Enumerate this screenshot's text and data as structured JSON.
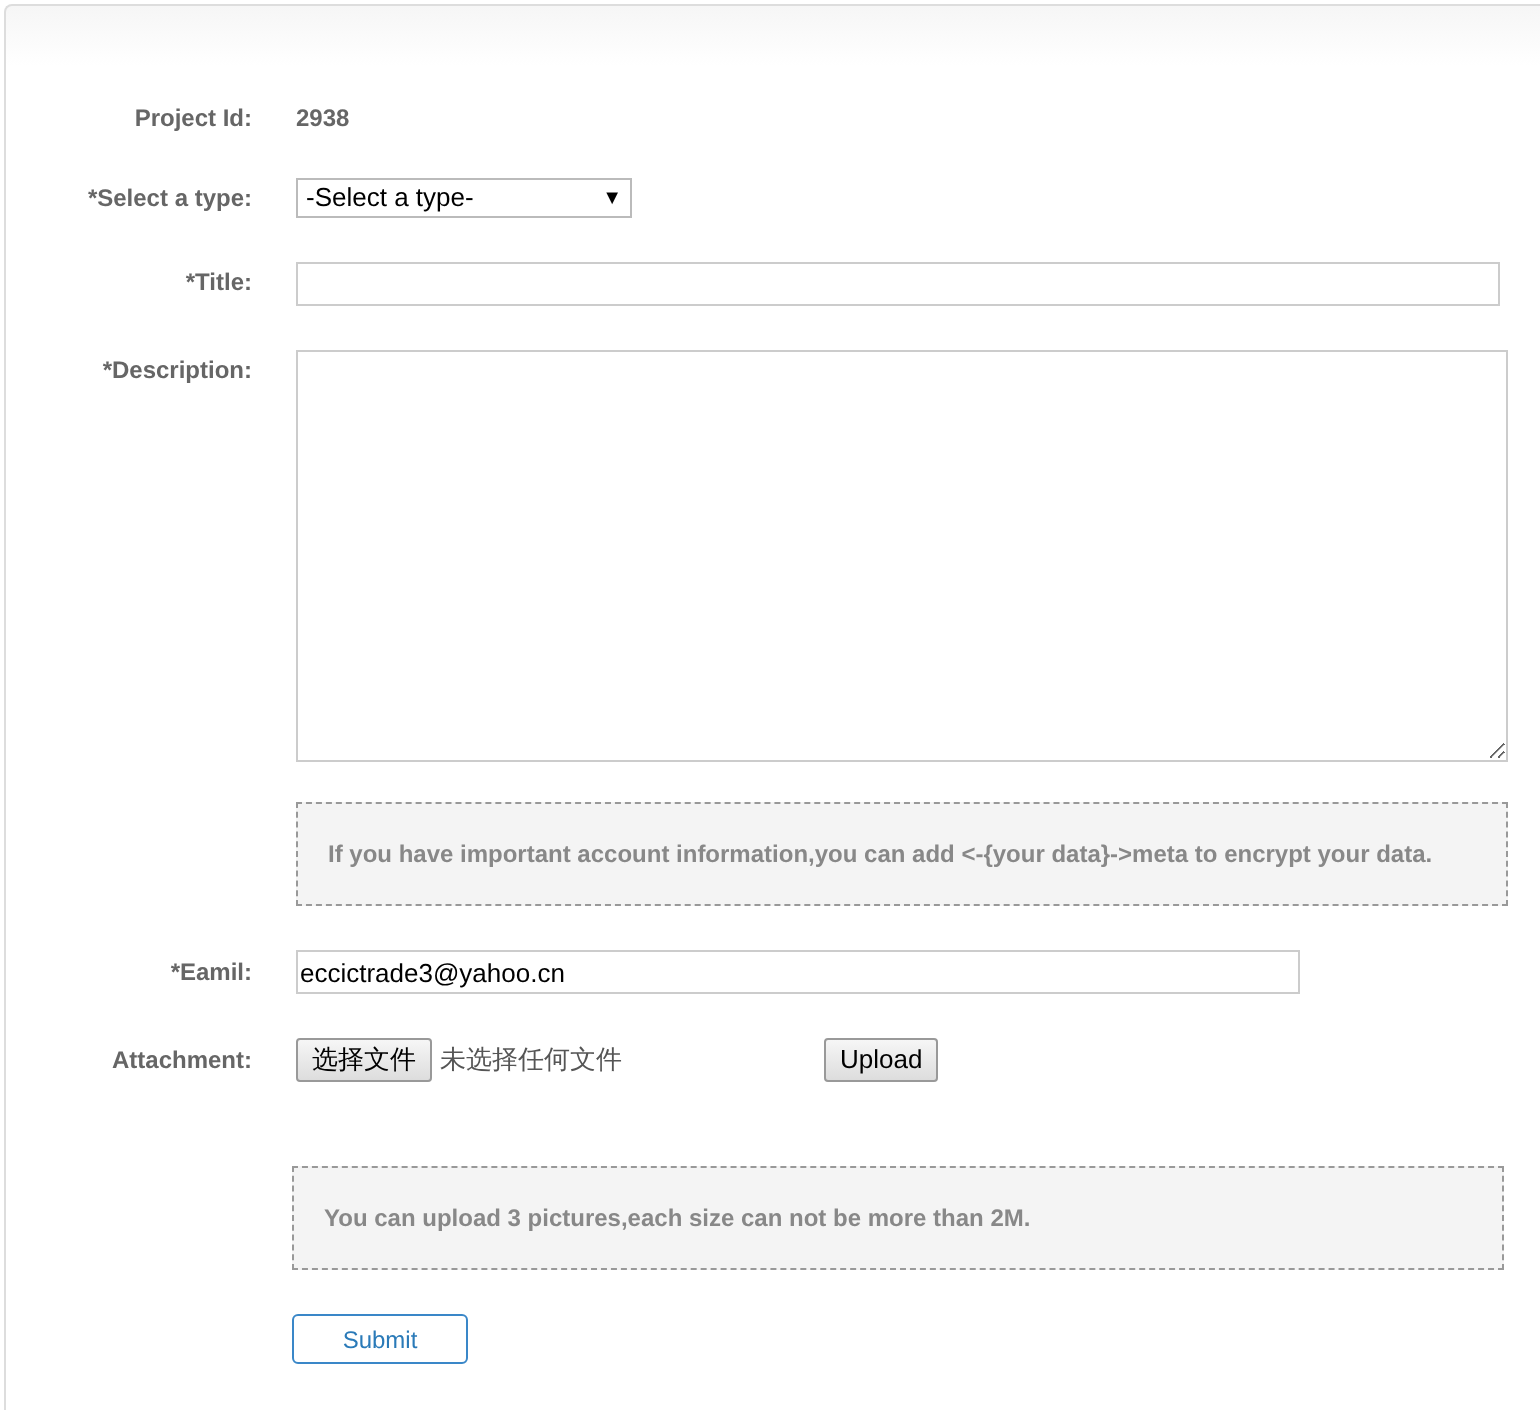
{
  "project_id": {
    "label": "Project Id:",
    "value": "2938"
  },
  "type_select": {
    "label": "*Select a type:",
    "value": "-Select a type-",
    "arrow": "▼"
  },
  "title": {
    "label": "*Title:"
  },
  "description": {
    "label": "*Description:"
  },
  "note_encrypt": "If you have important account information,you can add <-{your data}->meta to encrypt your data.",
  "email": {
    "label": "*Eamil:",
    "value": "eccictrade3@yahoo.cn"
  },
  "attachment": {
    "label": "Attachment:",
    "choose_button": "选择文件",
    "file_status": "未选择任何文件",
    "upload_button": "Upload"
  },
  "note_upload": "You can upload 3 pictures,each size can not be more than 2M.",
  "submit": "Submit"
}
